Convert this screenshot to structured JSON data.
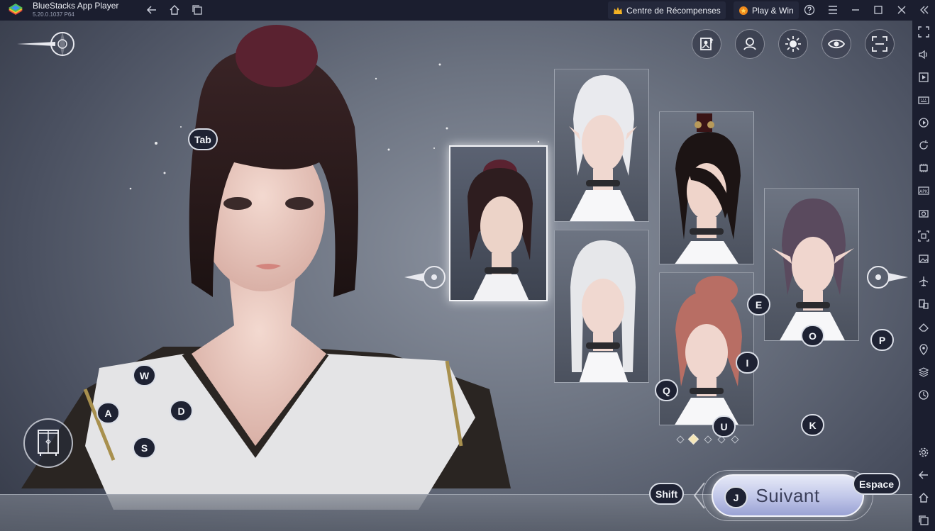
{
  "titlebar": {
    "app_name": "BlueStacks App Player",
    "version": "5.20.0.1037  P64",
    "rewards_label": "Centre de  Récompenses",
    "play_win_label": "Play & Win"
  },
  "keys": {
    "tab": "Tab",
    "w": "W",
    "a": "A",
    "d": "D",
    "s": "S",
    "e": "E",
    "o": "O",
    "p": "P",
    "i": "I",
    "q": "Q",
    "u": "U",
    "k": "K",
    "shift": "Shift",
    "j": "J",
    "space": "Espace"
  },
  "next_button_label": "Suivant",
  "pagination": {
    "count": 5,
    "active_index": 1
  },
  "presets": [
    {
      "name": "preset-1",
      "hair": "dark-burgundy bun",
      "selected": true
    },
    {
      "name": "preset-2",
      "hair": "white elf"
    },
    {
      "name": "preset-3",
      "hair": "black side-swept"
    },
    {
      "name": "preset-4",
      "hair": "white braided"
    },
    {
      "name": "preset-5",
      "hair": "pink ponytail"
    },
    {
      "name": "preset-6",
      "hair": "purple elf"
    }
  ],
  "colors": {
    "chrome_bg": "#1b1e2f",
    "key_bg": "#1e2233",
    "button_gradient_top": "#e6e9f7",
    "button_gradient_bottom": "#9aa2d4"
  }
}
